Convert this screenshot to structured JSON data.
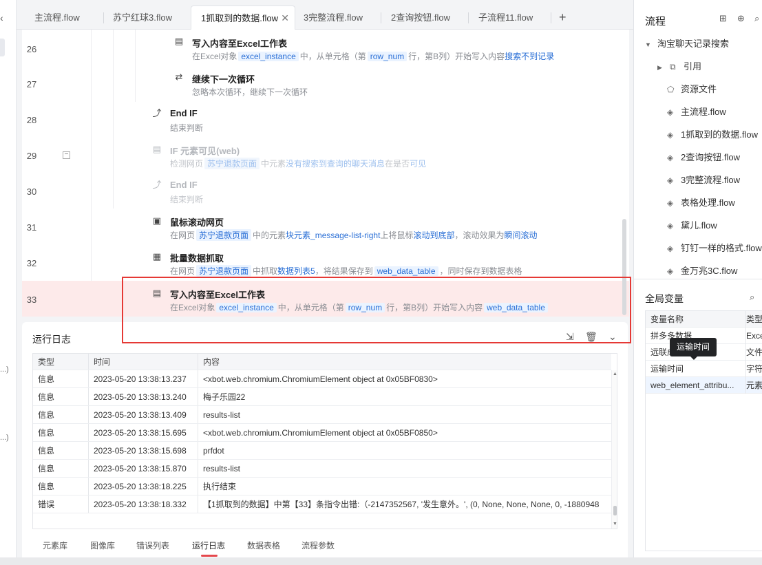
{
  "tabs": [
    {
      "label": "主流程.flow"
    },
    {
      "label": "苏宁红球3.flow"
    },
    {
      "label": "1抓取到的数据.flow",
      "active": true
    },
    {
      "label": "3完整流程.flow"
    },
    {
      "label": "2查询按钮.flow"
    },
    {
      "label": "子流程11.flow"
    }
  ],
  "tab_close": "✕",
  "tab_add": "+",
  "editor": {
    "rows": [
      {
        "line": "26",
        "title": "写入内容至Excel工作表",
        "desc": {
          "a": "在Excel对象",
          "b": "excel_instance",
          "c": "中，从单元格（第",
          "d": "row_num",
          "e": "行，第B列）开始写入内容",
          "f": "搜索不到记录"
        }
      },
      {
        "line": "27",
        "title": "继续下一次循环",
        "desc": "忽略本次循环，继续下一次循环"
      },
      {
        "line": "28",
        "title": "End IF",
        "desc": "结束判断"
      },
      {
        "line": "29",
        "title": "IF 元素可见(web)",
        "desc": {
          "a": "检测网页",
          "b": "苏宁退款页面",
          "c": "中元素",
          "d": "没有搜索到查询的聊天消息",
          "e": "在是否",
          "f": "可见"
        }
      },
      {
        "line": "30",
        "title": "End IF",
        "desc": "结束判断"
      },
      {
        "line": "31",
        "title": "鼠标滚动网页",
        "desc": {
          "a": "在网页",
          "b": "苏宁退款页面",
          "c": "中的元素",
          "d": "块元素_message-list-right",
          "e": "上将鼠标",
          "f": "滚动到底部",
          "g": "，滚动效果为",
          "h": "瞬间滚动"
        }
      },
      {
        "line": "32",
        "title": "批量数据抓取",
        "desc": {
          "a": "在网页",
          "b": "苏宁退款页面",
          "c": "中抓取",
          "d": "数据列表5",
          "e": "，将结果保存到",
          "f": "web_data_table",
          "g": "，同时保存到数据表格"
        }
      },
      {
        "line": "33",
        "title": "写入内容至Excel工作表",
        "desc": {
          "a": "在Excel对象",
          "b": "excel_instance",
          "c": "中，从单元格（第",
          "d": "row_num",
          "e": "行，第B列）开始写入内容",
          "f": "web_data_table"
        }
      }
    ]
  },
  "flow_panel": {
    "title": "流程",
    "root": "淘宝聊天记录搜索",
    "items": [
      "引用",
      "资源文件",
      "主流程.flow",
      "1抓取到的数据.flow",
      "2查询按钮.flow",
      "3完整流程.flow",
      "表格处理.flow",
      "黛儿.flow",
      "钉钉一样的格式.flow",
      "金万兆3C.flow"
    ]
  },
  "global_vars": {
    "title": "全局变量",
    "headers": [
      "变量名称",
      "类型"
    ],
    "rows": [
      {
        "name": "拼多多数据",
        "type": "Exce"
      },
      {
        "name": "远联成",
        "type": "文件"
      },
      {
        "name": "运输时间",
        "type": "字符"
      },
      {
        "name": "web_element_attribu...",
        "type": "元素"
      }
    ],
    "tooltip": "运输时间"
  },
  "log": {
    "title": "运行日志",
    "headers": [
      "类型",
      "时间",
      "内容"
    ],
    "rows": [
      {
        "type": "信息",
        "time": "2023-05-20 13:38:13.237",
        "content": "<xbot.web.chromium.ChromiumElement object at 0x05BF0830>"
      },
      {
        "type": "信息",
        "time": "2023-05-20 13:38:13.240",
        "content": "梅子乐园22"
      },
      {
        "type": "信息",
        "time": "2023-05-20 13:38:13.409",
        "content": "results-list"
      },
      {
        "type": "信息",
        "time": "2023-05-20 13:38:15.695",
        "content": "<xbot.web.chromium.ChromiumElement object at 0x05BF0850>"
      },
      {
        "type": "信息",
        "time": "2023-05-20 13:38:15.698",
        "content": "prfdot"
      },
      {
        "type": "信息",
        "time": "2023-05-20 13:38:15.870",
        "content": "results-list"
      },
      {
        "type": "信息",
        "time": "2023-05-20 13:38:18.225",
        "content": "执行结束"
      },
      {
        "type": "错误",
        "time": "2023-05-20 13:38:18.332",
        "content": "【1抓取到的数据】中第【33】条指令出错:（-2147352567, '发生意外。', (0, None, None, None, 0, -1880948"
      }
    ]
  },
  "bottom_tabs": [
    "元素库",
    "图像库",
    "错误列表",
    "运行日志",
    "数据表格",
    "流程参数"
  ],
  "left_strip": {
    "chevron": "‹",
    "frag1": "...)",
    "frag2": "...)"
  }
}
